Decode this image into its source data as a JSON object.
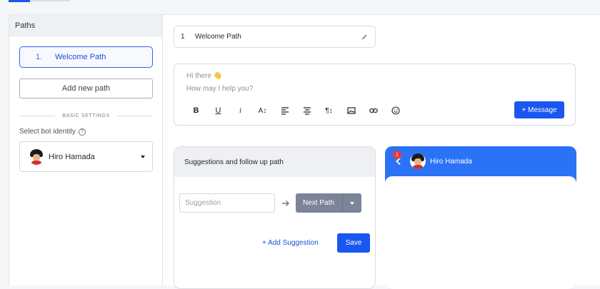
{
  "sidebar": {
    "title": "Paths",
    "path_item": {
      "number": "1.",
      "label": "Welcome Path"
    },
    "add_path_label": "Add new path",
    "divider_label": "BASIC SETTINGS",
    "identity_label": "Select bot identity",
    "help_icon": "?",
    "identity_value": "Hiro Hamada"
  },
  "main": {
    "path_name": {
      "number": "1",
      "value": "Welcome Path"
    },
    "editor": {
      "line1": "Hi there 👋",
      "line2": "How may I help you?",
      "toolbar": [
        "B",
        "U",
        "i",
        "A↕",
        "left-align-icon",
        "center-align-icon",
        "¶↕",
        "image-icon",
        "link-icon",
        "emoji-icon"
      ],
      "message_button": "+ Message"
    },
    "suggestions": {
      "title": "Suggestions and follow up path",
      "input_placeholder": "Suggestion",
      "next_path_label": "Next Path",
      "add_suggestion_label": "+ Add Suggestion",
      "save_label": "Save"
    },
    "preview": {
      "badge_count": "1",
      "bot_name": "Hiro Hamada"
    }
  },
  "colors": {
    "accent": "#1a56f0",
    "preview_header": "#2b73f6",
    "badge": "#e53935",
    "select_gray": "#7c8499"
  }
}
